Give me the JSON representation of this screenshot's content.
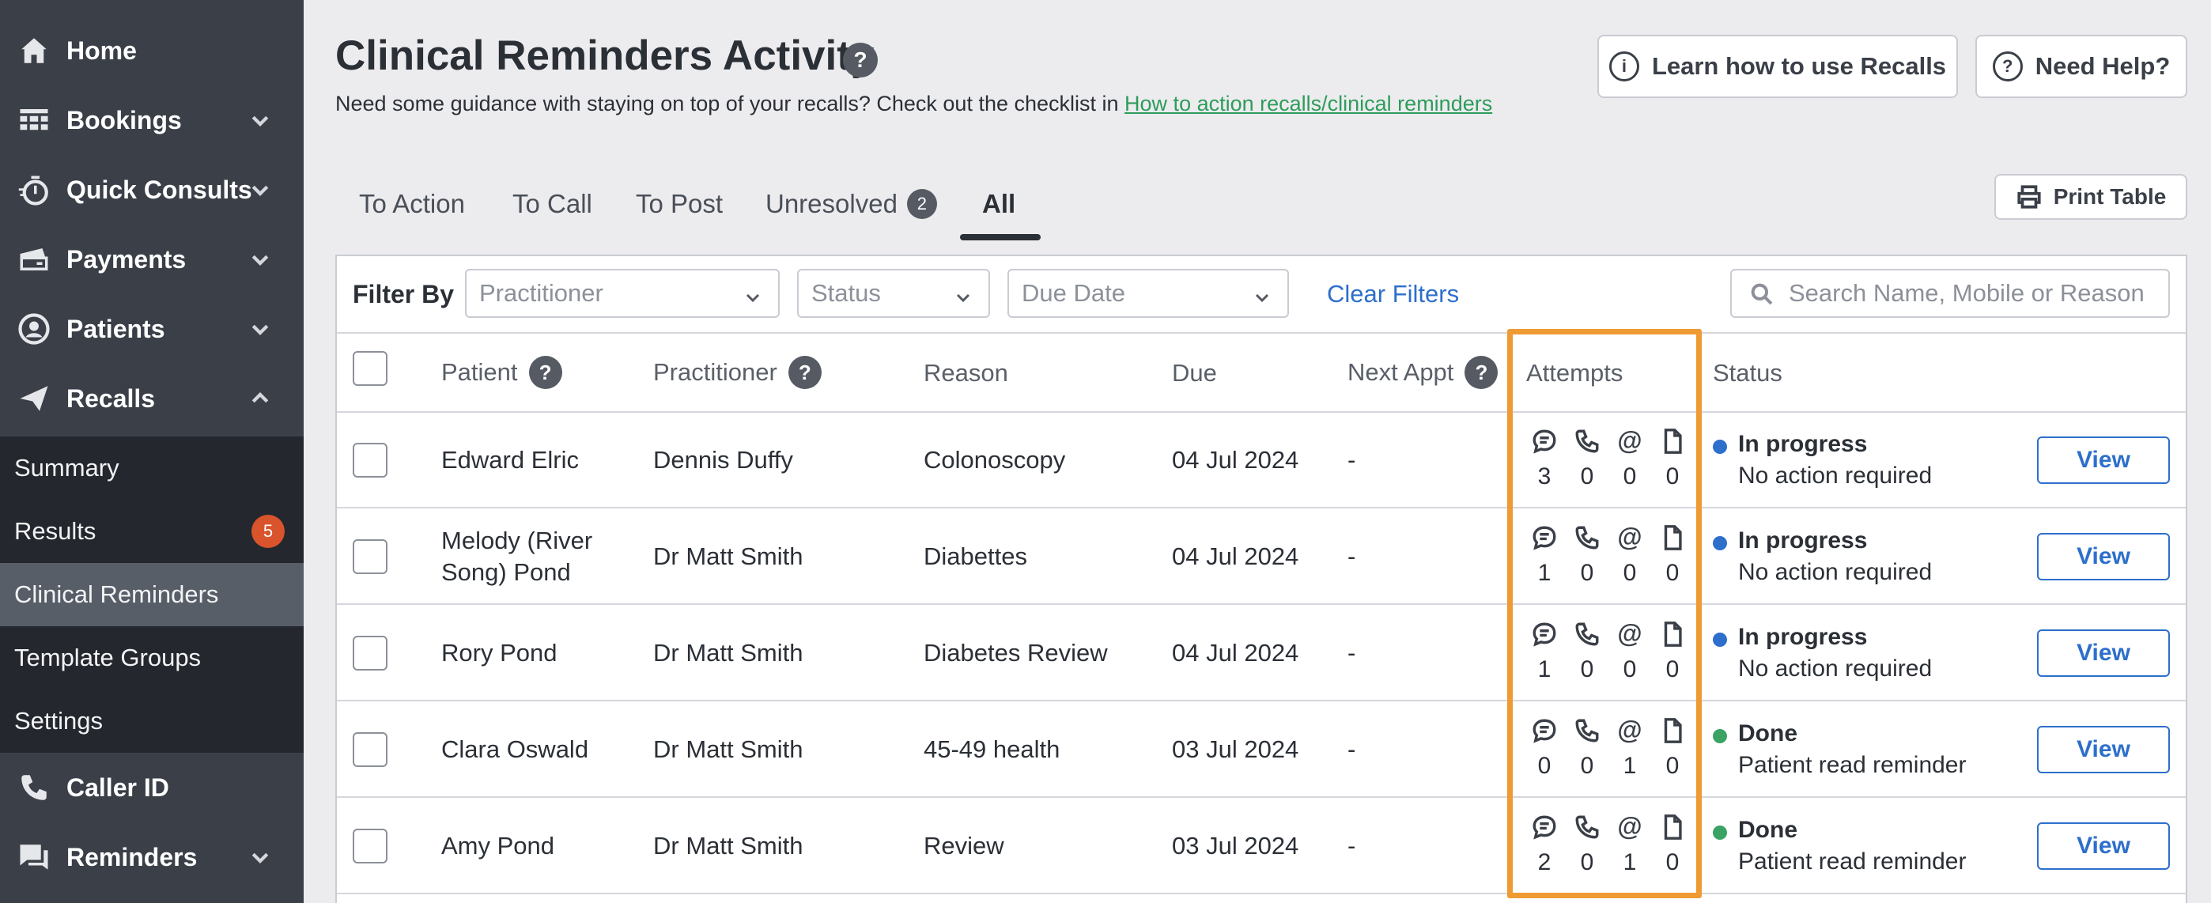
{
  "sidebar": {
    "items": [
      {
        "label": "Home",
        "icon": "home-icon"
      },
      {
        "label": "Bookings",
        "icon": "calendar-grid-icon"
      },
      {
        "label": "Quick Consults",
        "icon": "stopwatch-icon"
      },
      {
        "label": "Payments",
        "icon": "payment-card-icon"
      },
      {
        "label": "Patients",
        "icon": "user-circle-icon"
      },
      {
        "label": "Recalls",
        "icon": "paper-plane-icon"
      },
      {
        "label": "Caller ID",
        "icon": "phone-ring-icon"
      },
      {
        "label": "Reminders",
        "icon": "chat-icon"
      }
    ],
    "subitems": [
      {
        "label": "Summary"
      },
      {
        "label": "Results",
        "badge": "5"
      },
      {
        "label": "Clinical Reminders"
      },
      {
        "label": "Template Groups"
      },
      {
        "label": "Settings"
      }
    ]
  },
  "header": {
    "title": "Clinical Reminders Activity",
    "help_glyph": "?",
    "subtitle": "Need some guidance with staying on top of your recalls? Check out the checklist in ",
    "subtitle_link": "How to action recalls/clinical reminders",
    "learn_button": "Learn how to use Recalls",
    "learn_glyph": "i",
    "help_button": "Need Help?",
    "print_button": "Print Table"
  },
  "tabs": [
    {
      "label": "To Action"
    },
    {
      "label": "To Call"
    },
    {
      "label": "To Post"
    },
    {
      "label": "Unresolved",
      "badge": "2"
    },
    {
      "label": "All"
    }
  ],
  "filters": {
    "label": "Filter By",
    "practitioner_placeholder": "Practitioner",
    "status_placeholder": "Status",
    "due_date_placeholder": "Due Date",
    "clear": "Clear Filters",
    "search_placeholder": "Search Name, Mobile or Reason"
  },
  "table": {
    "headers": {
      "patient": "Patient",
      "practitioner": "Practitioner",
      "reason": "Reason",
      "due": "Due",
      "next_appt": "Next Appt",
      "attempts": "Attempts",
      "status": "Status"
    },
    "attempt_icons": [
      "sms-icon",
      "phone-icon",
      "email-at-icon",
      "letter-icon"
    ],
    "at_glyph": "@",
    "view_label": "View",
    "rows": [
      {
        "patient_line1": "Edward Elric",
        "patient_line2": "",
        "practitioner": "Dennis Duffy",
        "reason": "Colonoscopy",
        "due": "04 Jul 2024",
        "next_appt": "-",
        "attempts": [
          "3",
          "0",
          "0",
          "0"
        ],
        "status": "In progress",
        "status_detail": "No action required",
        "status_color": "#2d6fcb"
      },
      {
        "patient_line1": "Melody (River",
        "patient_line2": "Song) Pond",
        "practitioner": "Dr Matt Smith",
        "reason": "Diabettes",
        "due": "04 Jul 2024",
        "next_appt": "-",
        "attempts": [
          "1",
          "0",
          "0",
          "0"
        ],
        "status": "In progress",
        "status_detail": "No action required",
        "status_color": "#2d6fcb"
      },
      {
        "patient_line1": "Rory Pond",
        "patient_line2": "",
        "practitioner": "Dr Matt Smith",
        "reason": "Diabetes Review",
        "due": "04 Jul 2024",
        "next_appt": "-",
        "attempts": [
          "1",
          "0",
          "0",
          "0"
        ],
        "status": "In progress",
        "status_detail": "No action required",
        "status_color": "#2d6fcb"
      },
      {
        "patient_line1": "Clara Oswald",
        "patient_line2": "",
        "practitioner": "Dr Matt Smith",
        "reason": "45-49 health",
        "due": "03 Jul 2024",
        "next_appt": "-",
        "attempts": [
          "0",
          "0",
          "1",
          "0"
        ],
        "status": "Done",
        "status_detail": "Patient read reminder",
        "status_color": "#3aa364"
      },
      {
        "patient_line1": "Amy Pond",
        "patient_line2": "",
        "practitioner": "Dr Matt Smith",
        "reason": "Review",
        "due": "03 Jul 2024",
        "next_appt": "-",
        "attempts": [
          "2",
          "0",
          "1",
          "0"
        ],
        "status": "Done",
        "status_detail": "Patient read reminder",
        "status_color": "#3aa364"
      }
    ]
  },
  "colors": {
    "highlight": "#ef9a33",
    "accent": "#2d6fcb",
    "sidebar": "#3a3f48"
  }
}
